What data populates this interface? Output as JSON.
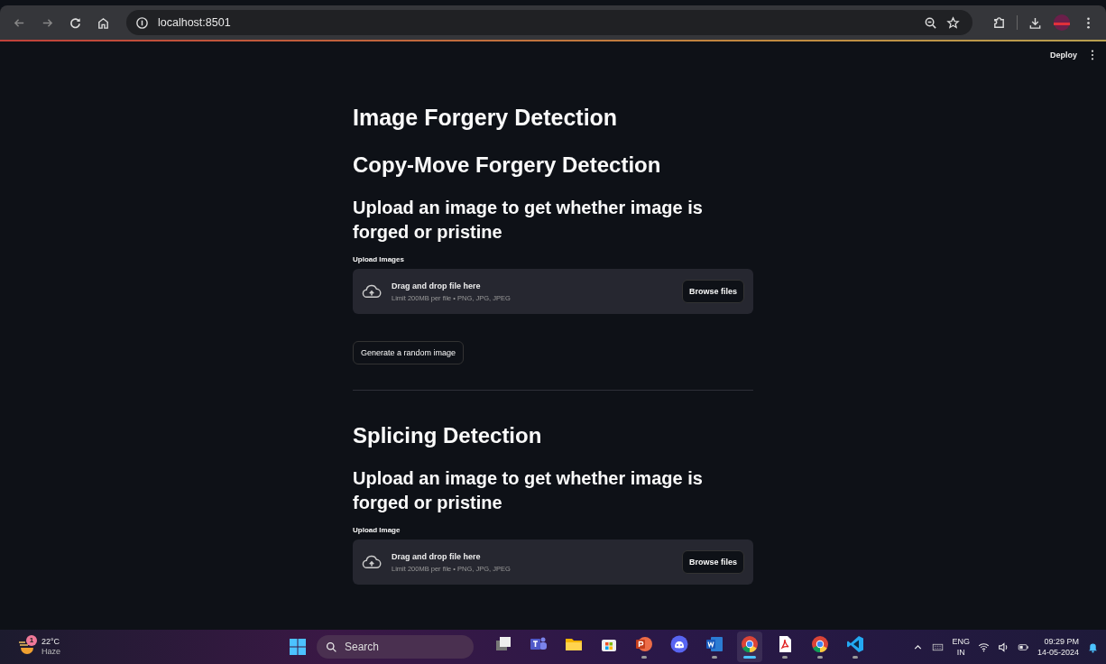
{
  "browser": {
    "url": "localhost:8501"
  },
  "app_header": {
    "deploy": "Deploy"
  },
  "title": "Image Forgery Detection",
  "sections": [
    {
      "heading": "Copy-Move Forgery Detection",
      "subheading": "Upload an image to get whether image is forged or pristine",
      "uploader": {
        "label": "Upload Images",
        "drop_text": "Drag and drop file here",
        "limit_text": "Limit 200MB per file • PNG, JPG, JPEG",
        "button": "Browse files"
      },
      "action_button": "Generate a random image"
    },
    {
      "heading": "Splicing Detection",
      "subheading": "Upload an image to get whether image is forged or pristine",
      "uploader": {
        "label": "Upload Image",
        "drop_text": "Drag and drop file here",
        "limit_text": "Limit 200MB per file • PNG, JPG, JPEG",
        "button": "Browse files"
      }
    }
  ],
  "taskbar": {
    "weather": {
      "badge": "1",
      "temperature": "22°C",
      "condition": "Haze"
    },
    "search": {
      "placeholder": "Search"
    },
    "apps": [
      {
        "kind": "taskview",
        "running": false,
        "selected": false
      },
      {
        "kind": "teams",
        "running": false,
        "selected": false
      },
      {
        "kind": "folder",
        "running": false,
        "selected": false
      },
      {
        "kind": "store",
        "running": false,
        "selected": false
      },
      {
        "kind": "powerpoint",
        "running": true,
        "selected": false
      },
      {
        "kind": "discord",
        "running": false,
        "selected": false
      },
      {
        "kind": "word",
        "running": true,
        "selected": false
      },
      {
        "kind": "chrome",
        "running": true,
        "selected": true
      },
      {
        "kind": "pdf",
        "running": true,
        "selected": false
      },
      {
        "kind": "chrome",
        "running": true,
        "selected": false
      },
      {
        "kind": "vscode",
        "running": true,
        "selected": false
      }
    ],
    "tray": {
      "language": "ENG",
      "region": "IN",
      "time": "09:29 PM",
      "date": "14-05-2024"
    }
  }
}
